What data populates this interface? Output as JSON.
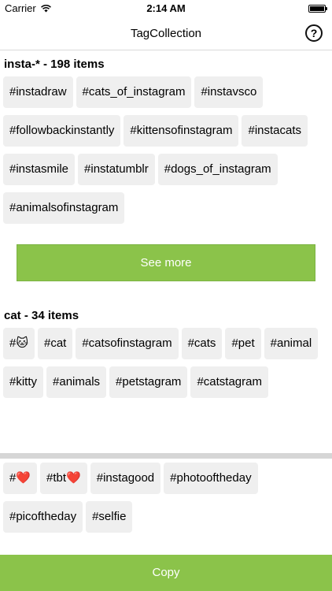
{
  "status_bar": {
    "carrier": "Carrier",
    "time": "2:14 AM",
    "icons": [
      "wifi-icon",
      "battery-icon"
    ]
  },
  "nav": {
    "title": "TagCollection",
    "help_label": "?",
    "help_icon": "help-circle-icon"
  },
  "sections": [
    {
      "title": "insta-* - 198 items",
      "tags": [
        "#instadraw",
        "#cats_of_instagram",
        "#instavsco",
        "#followbackinstantly",
        "#kittensofinstagram",
        "#instacats",
        "#instasmile",
        "#instatumblr",
        "#dogs_of_instagram",
        "#animalsofinstagram"
      ],
      "see_more_label": "See more"
    },
    {
      "title": "cat - 34 items",
      "tags": [
        "#🐱",
        "#cat",
        "#catsofinstagram",
        "#cats",
        "#pet",
        "#animal",
        "#kitty",
        "#animals",
        "#petstagram",
        "#catstagram"
      ]
    }
  ],
  "selected_tags": [
    "#❤️",
    "#tbt❤️",
    "#instagood",
    "#photooftheday",
    "#picoftheday",
    "#selfie"
  ],
  "copy_label": "Copy",
  "colors": {
    "accent_green": "#8bc34a",
    "tag_background": "#efefef",
    "divider": "#d6d6d6"
  }
}
